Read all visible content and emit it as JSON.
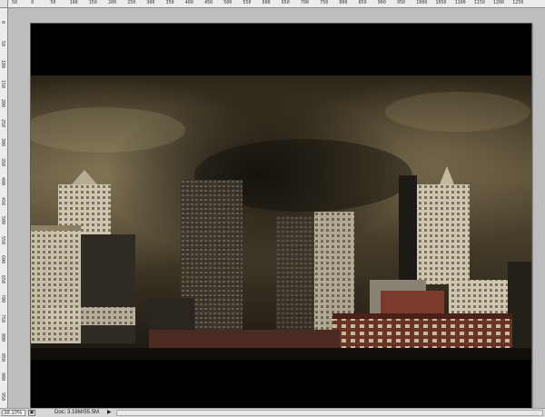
{
  "ruler": {
    "top_ticks": [
      "50",
      "0",
      "50",
      "100",
      "150",
      "200",
      "250",
      "300",
      "350",
      "400",
      "450",
      "500",
      "550",
      "600",
      "650",
      "700",
      "750",
      "800",
      "850",
      "900",
      "950",
      "1000",
      "1050",
      "1100",
      "1150",
      "1200",
      "1250"
    ],
    "left_ticks": [
      "0",
      "50",
      "100",
      "150",
      "200",
      "250",
      "300",
      "350",
      "400",
      "450",
      "500",
      "550",
      "600",
      "650",
      "700",
      "750",
      "800",
      "850",
      "900",
      "950"
    ]
  },
  "canvas": {
    "image": "dark stormy city skyline with brown clouds",
    "letterbox_color": "#000000"
  },
  "status": {
    "zoom": "38.10%",
    "doc_info": "Doc: 3.16M/55.5M",
    "arrow_icon": "right-triangle-icon",
    "icon": "navigator-icon"
  }
}
